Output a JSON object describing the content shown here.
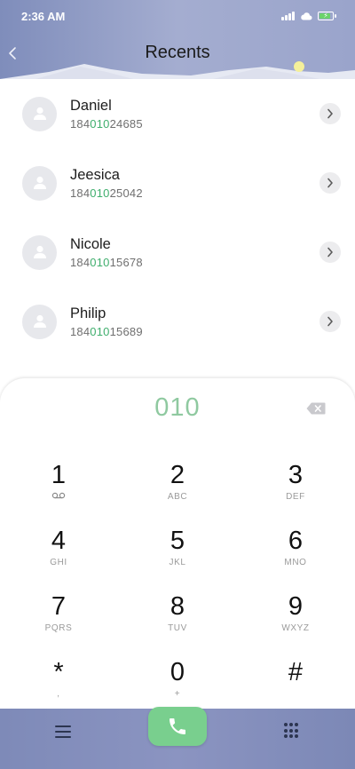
{
  "status_bar": {
    "time": "2:36 AM",
    "icons": [
      "signal-icon",
      "cloud-icon",
      "battery-charging-icon"
    ]
  },
  "header": {
    "title": "Recents",
    "back_icon": "chevron-left-icon"
  },
  "contacts": [
    {
      "name": "Daniel",
      "number_prefix": "184",
      "number_match": "010",
      "number_suffix": "24685"
    },
    {
      "name": "Jeesica",
      "number_prefix": "184",
      "number_match": "010",
      "number_suffix": "25042"
    },
    {
      "name": "Nicole",
      "number_prefix": "184",
      "number_match": "010",
      "number_suffix": "15678"
    },
    {
      "name": "Philip",
      "number_prefix": "184",
      "number_match": "010",
      "number_suffix": "15689"
    }
  ],
  "dialer": {
    "input": "010",
    "keys": [
      {
        "digit": "1",
        "letters": ""
      },
      {
        "digit": "2",
        "letters": "ABC"
      },
      {
        "digit": "3",
        "letters": "DEF"
      },
      {
        "digit": "4",
        "letters": "GHI"
      },
      {
        "digit": "5",
        "letters": "JKL"
      },
      {
        "digit": "6",
        "letters": "MNO"
      },
      {
        "digit": "7",
        "letters": "PQRS"
      },
      {
        "digit": "8",
        "letters": "TUV"
      },
      {
        "digit": "9",
        "letters": "WXYZ"
      },
      {
        "digit": "*",
        "letters": ","
      },
      {
        "digit": "0",
        "letters": "+"
      },
      {
        "digit": "#",
        "letters": ""
      }
    ]
  },
  "bottom_bar": {
    "icons": [
      "menu-icon",
      "phone-icon",
      "keypad-icon"
    ]
  },
  "colors": {
    "accent_green": "#3fae6d",
    "dial_input": "#8fc9a0",
    "call_button": "#79cf8e",
    "header_bar": "#8f9ac5"
  }
}
